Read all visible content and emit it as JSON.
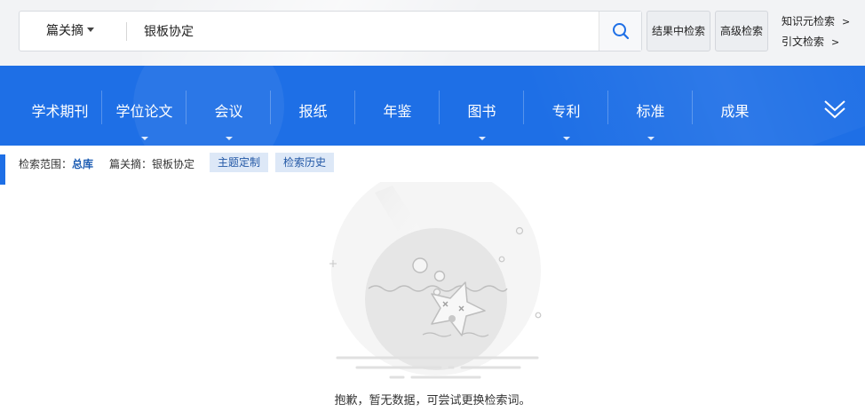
{
  "header": {
    "scope_label": "篇关摘",
    "search_value": "银板协定",
    "search_placeholder": "",
    "search_in_results": "结果中检索",
    "advanced_search": "高级检索",
    "knowledge_search": "知识元检索",
    "citation_search": "引文检索",
    "arrow": ">"
  },
  "nav": {
    "items": [
      {
        "label": "学术期刊",
        "has_sub": false
      },
      {
        "label": "学位论文",
        "has_sub": true
      },
      {
        "label": "会议",
        "has_sub": true
      },
      {
        "label": "报纸",
        "has_sub": false
      },
      {
        "label": "年鉴",
        "has_sub": false
      },
      {
        "label": "图书",
        "has_sub": true
      },
      {
        "label": "专利",
        "has_sub": true
      },
      {
        "label": "标准",
        "has_sub": true
      },
      {
        "label": "成果",
        "has_sub": false
      }
    ]
  },
  "info": {
    "range_label": "检索范围：",
    "range_value": "总库",
    "query_label": "篇关摘：",
    "query_value": "银板协定",
    "topic_button": "主题定制",
    "history_button": "检索历史"
  },
  "empty": {
    "message": "抱歉，暂无数据，可尝试更换检索词。"
  },
  "colors": {
    "nav_blue": "#1e6fe6",
    "link_blue": "#1d5db3",
    "tag_bg": "#dde8f7"
  }
}
